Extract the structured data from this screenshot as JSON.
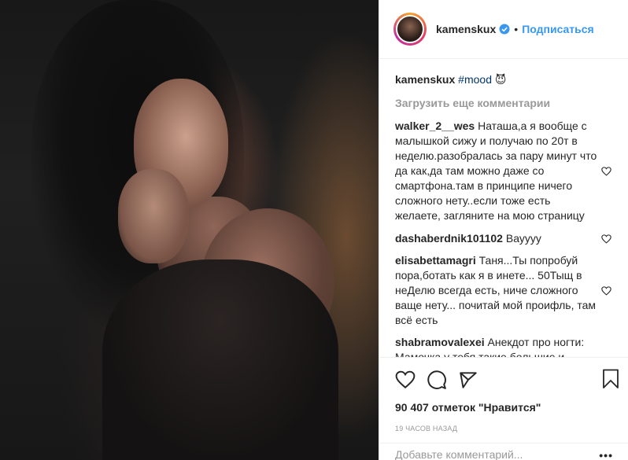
{
  "post": {
    "photo_alt": "Фото",
    "author": {
      "username": "kamenskux",
      "verified": true,
      "follow_label": "Подписаться",
      "separator": "•"
    },
    "caption": {
      "username": "kamenskux",
      "text": "#mood",
      "emoji": "😈"
    },
    "load_more_label": "Загрузить еще комментарии",
    "comments": [
      {
        "username": "walker_2__wes",
        "text": "Наташа,а я вообще с малышкой сижу и получаю по 20т в неделю.разобралась за пару минут что да как,да там можно даже со смартфона.там в принципе ничего сложного нету..если тоже есть желаете, загляните на мою страницу"
      },
      {
        "username": "dashaberdnik101102",
        "text": "Вауууу"
      },
      {
        "username": "elisabettamagri",
        "text": "Таня...Ты попробуй пора,ботать как я в инете... 50Тыщ в неДелю всегда есть, ниче сложного ваще нету... почитай мой проифль, там всё есть"
      },
      {
        "username": "shabramovalexei",
        "text": "Анекдот про ногти: Мамочка у тебя такие большие и красивые ногти - наверное по деревьям лазить классно! :-)"
      }
    ],
    "likes_text": "90 407 отметок \"Нравится\"",
    "timestamp": "19 ЧАСОВ НАЗАД",
    "add_comment_placeholder": "Добавьте комментарий...",
    "more_label": "•••"
  },
  "colors": {
    "accent": "#3897f0",
    "text": "#262626",
    "muted": "#999999",
    "border": "#efefef"
  },
  "icons": [
    "verified-badge-icon",
    "heart-icon",
    "comment-icon",
    "share-icon",
    "bookmark-icon"
  ]
}
